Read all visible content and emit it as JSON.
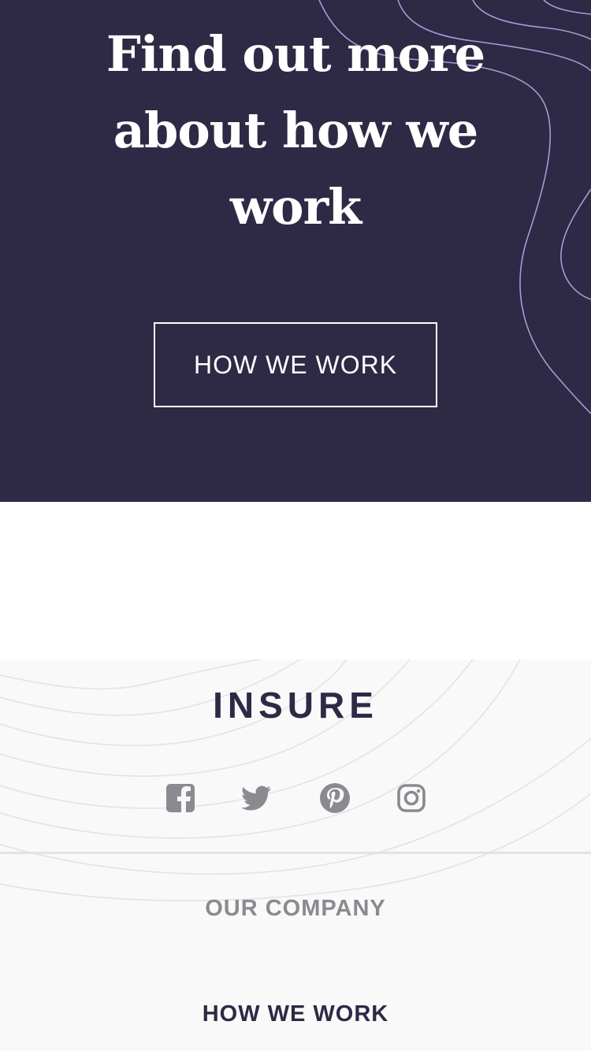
{
  "hero": {
    "title": "Find out more about how we work",
    "button_label": "HOW WE WORK"
  },
  "footer": {
    "logo_text": "INSURE",
    "social_icons": [
      "facebook-icon",
      "twitter-icon",
      "pinterest-icon",
      "instagram-icon"
    ],
    "links": {
      "our_company": "OUR COMPANY",
      "how_we_work": "HOW WE WORK"
    }
  },
  "colors": {
    "hero_background": "#2e2944",
    "pattern_lines": "#a79ad8",
    "footer_background": "#f9f9f9",
    "icon_gray": "#8c8a90"
  }
}
